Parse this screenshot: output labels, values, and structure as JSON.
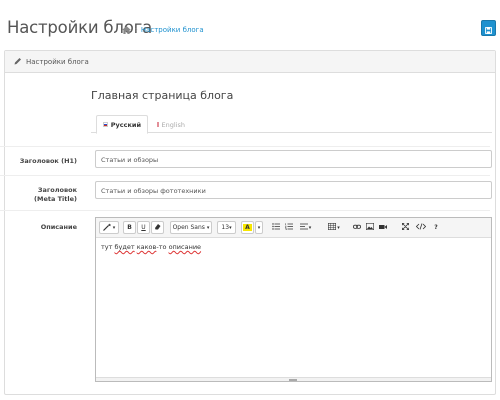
{
  "header": {
    "title": "Настройки блога",
    "breadcrumb": "Настройки блога",
    "breadcrumb_sep": "›"
  },
  "panel": {
    "title": "Настройки блога",
    "section_title": "Главная страница блога"
  },
  "tabs": [
    {
      "label": "Русский",
      "active": true
    },
    {
      "label": "English",
      "active": false
    }
  ],
  "fields": {
    "h1": {
      "label": "Заголовок (H1)",
      "value": "Статьи и обзоры"
    },
    "meta_title": {
      "label": "Заголовок (Meta Title)",
      "value": "Статьи и обзоры фототехники"
    },
    "description": {
      "label": "Описание"
    }
  },
  "editor": {
    "font_name": "Open Sans",
    "font_size": "13",
    "content_parts": [
      "тут ",
      "будет",
      " ",
      "каков",
      "-то ",
      "описание"
    ]
  },
  "colors": {
    "accent": "#1e91cf",
    "highlight": "#f7e600"
  }
}
